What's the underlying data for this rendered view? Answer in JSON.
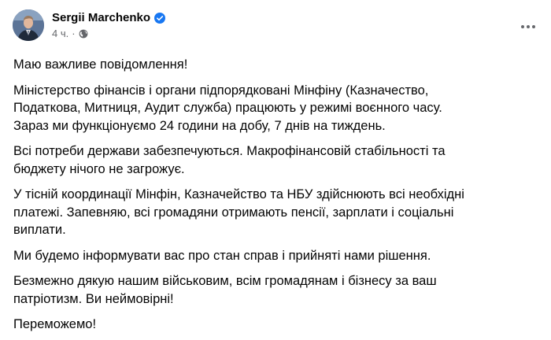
{
  "post": {
    "author_name": "Sergii Marchenko",
    "time": "4 ч.",
    "separator": "·",
    "icons": {
      "verified": "verified-badge-icon",
      "privacy": "globe-icon",
      "more": "more-options-icon"
    },
    "colors": {
      "verified": "#1877f2",
      "meta_text": "#65676b",
      "text": "#050505"
    },
    "paragraphs": [
      "Маю важливе повідомлення!",
      "Міністерство фінансів і органи підпорядковані Мінфіну (Казначество,\nПодаткова, Митниця, Аудит служба) працюють у режимі воєнного часу.\nЗараз ми функціонуємо 24 години на добу, 7 днів на тиждень.",
      "Всі потреби держави забезпечуються. Макрофінансовій стабільності та\nбюджету нічого не загрожує.",
      "У тісній координації Мінфін, Казначейство та НБУ здійснюють всі необхідні\nплатежі. Запевняю, всі громадяни отримають пенсії, зарплати і соціальні\nвиплати.",
      "Ми будемо інформувати вас про стан справ і прийняті нами рішення.",
      "Безмежно дякую нашим військовим, всім громадянам і бізнесу за ваш\nпатріотизм. Ви неймовірні!",
      "Переможемо!"
    ]
  }
}
